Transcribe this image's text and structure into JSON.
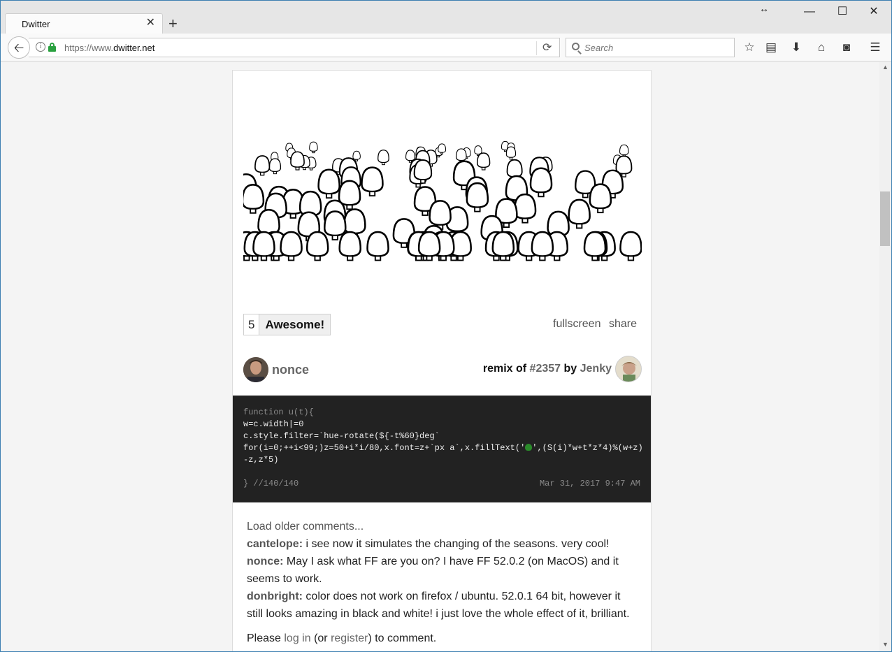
{
  "browser": {
    "tab_title": "Dwitter",
    "url_protocol": "https://www.",
    "url_domain": "dwitter.net",
    "search_placeholder": "Search"
  },
  "post": {
    "vote_count": "5",
    "vote_label": "Awesome!",
    "fullscreen_label": "fullscreen",
    "share_label": "share",
    "author": "nonce",
    "remix_prefix": "remix of",
    "remix_id": "#2357",
    "remix_by": "by",
    "remix_user": "Jenky",
    "code_header": "function u(t){",
    "code_lines": [
      "w=c.width|=0",
      "c.style.filter=`hue-rotate(${-t%60}deg`",
      "for(i=0;++i<99;)z=50+i*i/80,x.font=z+`px a`,x.fillText('",
      "',(S(i)*w+t*z*4)%(w+z)",
      "-z,z*5)"
    ],
    "code_footer": "} //140/140",
    "code_date": "Mar 31, 2017 9:47 AM"
  },
  "comments": {
    "load_older": "Load older comments...",
    "items": [
      {
        "user": "cantelope:",
        "text": " i see now it simulates the changing of the seasons. very cool!"
      },
      {
        "user": "nonce:",
        "text": " May I ask what FF are you on? I have FF 52.0.2 (on MacOS) and it seems to work."
      },
      {
        "user": "donbright:",
        "text": " color does not work on firefox / ubuntu. 52.0.1 64 bit, however it still looks amazing in black and white! i just love the whole effect of it, brilliant."
      }
    ],
    "login_prefix": "Please ",
    "login_link": "log in",
    "login_mid": " (or ",
    "register_link": "register",
    "login_suffix": ") to comment."
  }
}
